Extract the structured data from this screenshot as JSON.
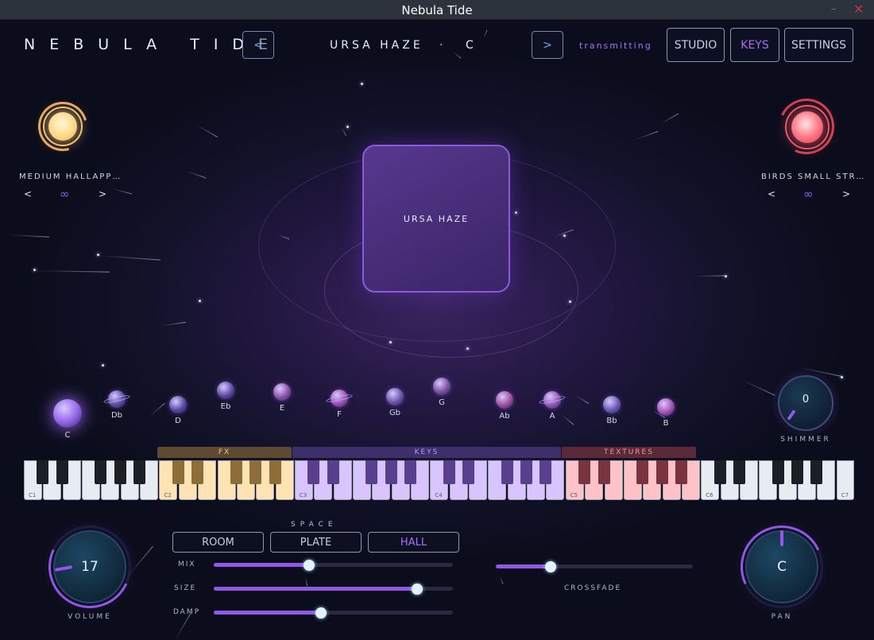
{
  "window": {
    "title": "Nebula Tide",
    "minimize_glyph": "–",
    "close_glyph": "✕"
  },
  "header": {
    "brand": "NEBULA TIDE",
    "prev_label": "<",
    "next_label": ">",
    "preset_name": "URSA HAZE",
    "preset_separator": "·",
    "preset_key": "C",
    "status": "transmitting",
    "tabs": [
      {
        "label": "STUDIO",
        "active": false
      },
      {
        "label": "KEYS",
        "active": true
      },
      {
        "label": "SETTINGS",
        "active": false
      }
    ]
  },
  "left_slot": {
    "name": "MEDIUM HALLAPP…",
    "prev": "<",
    "next": ">",
    "mode_glyph": "∞",
    "orb_icon": "sun-orb-icon",
    "color": "#ffcf7a"
  },
  "right_slot": {
    "name": "BIRDS SMALL STR…",
    "prev": "<",
    "next": ">",
    "mode_glyph": "∞",
    "orb_icon": "red-star-orb-icon",
    "color": "#ff5c6c"
  },
  "center_pad": {
    "label": "URSA HAZE"
  },
  "notes": [
    "C",
    "Db",
    "D",
    "Eb",
    "E",
    "F",
    "Gb",
    "G",
    "Ab",
    "A",
    "Bb",
    "B"
  ],
  "keyboard": {
    "octave_labels": [
      "C1",
      "C2",
      "C3",
      "C4",
      "C5",
      "C6",
      "C7"
    ],
    "zones": [
      {
        "label": "FX",
        "color": "#ffd59a"
      },
      {
        "label": "KEYS",
        "color": "#cbb5ff"
      },
      {
        "label": "TEXTURES",
        "color": "#ffb3b8"
      }
    ]
  },
  "shimmer": {
    "label": "SHIMMER",
    "value": "0"
  },
  "volume": {
    "label": "VOLUME",
    "value": "17"
  },
  "pan": {
    "label": "PAN",
    "value": "C"
  },
  "space": {
    "title": "SPACE",
    "buttons": [
      {
        "label": "ROOM",
        "active": false
      },
      {
        "label": "PLATE",
        "active": false
      },
      {
        "label": "HALL",
        "active": true
      }
    ],
    "sliders": [
      {
        "label": "MIX",
        "value": 0.4
      },
      {
        "label": "SIZE",
        "value": 0.85
      },
      {
        "label": "DAMP",
        "value": 0.45
      }
    ]
  },
  "crossfade": {
    "label": "CROSSFADE",
    "value": 0.28
  },
  "colors": {
    "accent": "#9257e6",
    "accent_text": "#a673ff",
    "fx_zone": "#ffd59a",
    "keys_zone": "#cbb5ff",
    "textures_zone": "#ffb3b8"
  }
}
